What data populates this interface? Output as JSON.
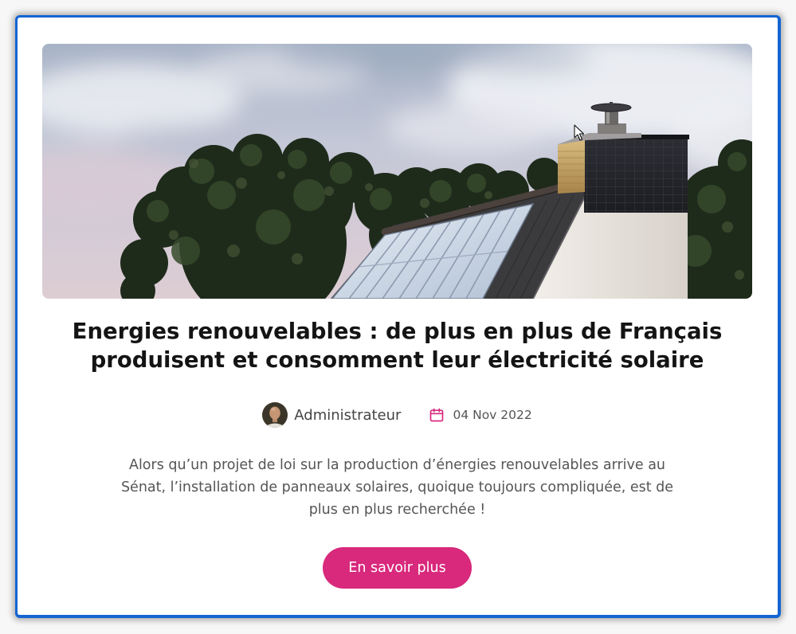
{
  "article": {
    "title": "Energies renouvelables : de plus en plus de Français produisent et consomment leur électricité solaire",
    "author": "Administrateur",
    "date": "04 Nov 2022",
    "excerpt": "Alors qu’un projet de loi sur la production d’énergies renouvelables arrive au Sénat, l’installation de panneaux solaires, quoique toujours compliquée, est de plus en plus recherchée !",
    "button_label": "En savoir plus"
  },
  "icons": {
    "date": "calendar-icon",
    "cursor": "mouse-cursor-icon"
  },
  "colors": {
    "accent": "#d8297c",
    "frame": "#1464d2",
    "title": "#141414",
    "text": "#555555",
    "muted": "#444444"
  }
}
